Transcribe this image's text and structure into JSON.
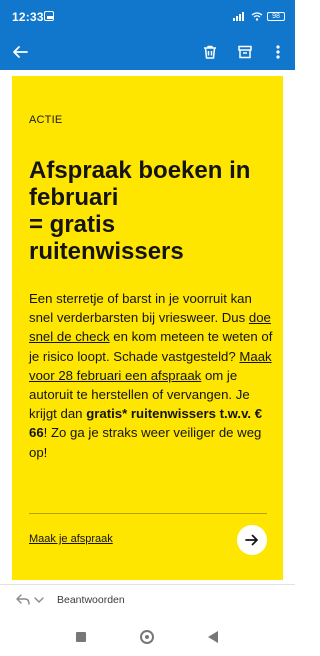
{
  "status_bar": {
    "time": "12:33",
    "battery": "98"
  },
  "toolbar": {
    "back_icon": "arrow-left-icon",
    "delete_icon": "trash-icon",
    "archive_icon": "archive-icon",
    "more_icon": "more-vert-icon",
    "color": "#1177cc"
  },
  "email": {
    "tag": "ACTIE",
    "headline_lines": [
      "Afspraak boeken in",
      "februari",
      "= gratis",
      "ruitenwissers"
    ],
    "body": {
      "p1": "Een sterretje of barst in je voorruit kan snel verderbarsten bij vriesweer. Dus ",
      "link1": "doe snel de check",
      "p2": " en kom meteen te weten of je risico loopt. Schade vastgesteld? ",
      "link2": "Maak voor 28 februari een afspraak",
      "p3": " om je autoruit te herstellen of vervangen. Je krijgt dan ",
      "bold": "gratis* ruitenwissers t.w.v. € 66",
      "p4": "! Zo ga je straks weer veiliger de weg op!"
    },
    "cta_label": "Maak je afspraak",
    "cta_icon": "arrow-right-icon",
    "card_color": "#ffe600"
  },
  "reply": {
    "label": "Beantwoorden",
    "icon": "reply-icon"
  },
  "nav": {
    "recents_icon": "square-icon",
    "home_icon": "circle-icon",
    "back_icon": "triangle-back-icon"
  }
}
